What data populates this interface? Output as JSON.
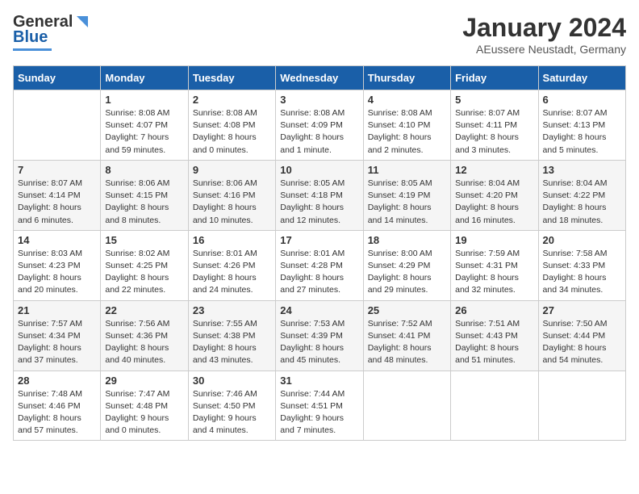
{
  "header": {
    "logo_general": "General",
    "logo_blue": "Blue",
    "month_title": "January 2024",
    "location": "AEussere Neustadt, Germany"
  },
  "days_of_week": [
    "Sunday",
    "Monday",
    "Tuesday",
    "Wednesday",
    "Thursday",
    "Friday",
    "Saturday"
  ],
  "weeks": [
    [
      {
        "day": "",
        "info": ""
      },
      {
        "day": "1",
        "info": "Sunrise: 8:08 AM\nSunset: 4:07 PM\nDaylight: 7 hours\nand 59 minutes."
      },
      {
        "day": "2",
        "info": "Sunrise: 8:08 AM\nSunset: 4:08 PM\nDaylight: 8 hours\nand 0 minutes."
      },
      {
        "day": "3",
        "info": "Sunrise: 8:08 AM\nSunset: 4:09 PM\nDaylight: 8 hours\nand 1 minute."
      },
      {
        "day": "4",
        "info": "Sunrise: 8:08 AM\nSunset: 4:10 PM\nDaylight: 8 hours\nand 2 minutes."
      },
      {
        "day": "5",
        "info": "Sunrise: 8:07 AM\nSunset: 4:11 PM\nDaylight: 8 hours\nand 3 minutes."
      },
      {
        "day": "6",
        "info": "Sunrise: 8:07 AM\nSunset: 4:13 PM\nDaylight: 8 hours\nand 5 minutes."
      }
    ],
    [
      {
        "day": "7",
        "info": "Sunrise: 8:07 AM\nSunset: 4:14 PM\nDaylight: 8 hours\nand 6 minutes."
      },
      {
        "day": "8",
        "info": "Sunrise: 8:06 AM\nSunset: 4:15 PM\nDaylight: 8 hours\nand 8 minutes."
      },
      {
        "day": "9",
        "info": "Sunrise: 8:06 AM\nSunset: 4:16 PM\nDaylight: 8 hours\nand 10 minutes."
      },
      {
        "day": "10",
        "info": "Sunrise: 8:05 AM\nSunset: 4:18 PM\nDaylight: 8 hours\nand 12 minutes."
      },
      {
        "day": "11",
        "info": "Sunrise: 8:05 AM\nSunset: 4:19 PM\nDaylight: 8 hours\nand 14 minutes."
      },
      {
        "day": "12",
        "info": "Sunrise: 8:04 AM\nSunset: 4:20 PM\nDaylight: 8 hours\nand 16 minutes."
      },
      {
        "day": "13",
        "info": "Sunrise: 8:04 AM\nSunset: 4:22 PM\nDaylight: 8 hours\nand 18 minutes."
      }
    ],
    [
      {
        "day": "14",
        "info": "Sunrise: 8:03 AM\nSunset: 4:23 PM\nDaylight: 8 hours\nand 20 minutes."
      },
      {
        "day": "15",
        "info": "Sunrise: 8:02 AM\nSunset: 4:25 PM\nDaylight: 8 hours\nand 22 minutes."
      },
      {
        "day": "16",
        "info": "Sunrise: 8:01 AM\nSunset: 4:26 PM\nDaylight: 8 hours\nand 24 minutes."
      },
      {
        "day": "17",
        "info": "Sunrise: 8:01 AM\nSunset: 4:28 PM\nDaylight: 8 hours\nand 27 minutes."
      },
      {
        "day": "18",
        "info": "Sunrise: 8:00 AM\nSunset: 4:29 PM\nDaylight: 8 hours\nand 29 minutes."
      },
      {
        "day": "19",
        "info": "Sunrise: 7:59 AM\nSunset: 4:31 PM\nDaylight: 8 hours\nand 32 minutes."
      },
      {
        "day": "20",
        "info": "Sunrise: 7:58 AM\nSunset: 4:33 PM\nDaylight: 8 hours\nand 34 minutes."
      }
    ],
    [
      {
        "day": "21",
        "info": "Sunrise: 7:57 AM\nSunset: 4:34 PM\nDaylight: 8 hours\nand 37 minutes."
      },
      {
        "day": "22",
        "info": "Sunrise: 7:56 AM\nSunset: 4:36 PM\nDaylight: 8 hours\nand 40 minutes."
      },
      {
        "day": "23",
        "info": "Sunrise: 7:55 AM\nSunset: 4:38 PM\nDaylight: 8 hours\nand 43 minutes."
      },
      {
        "day": "24",
        "info": "Sunrise: 7:53 AM\nSunset: 4:39 PM\nDaylight: 8 hours\nand 45 minutes."
      },
      {
        "day": "25",
        "info": "Sunrise: 7:52 AM\nSunset: 4:41 PM\nDaylight: 8 hours\nand 48 minutes."
      },
      {
        "day": "26",
        "info": "Sunrise: 7:51 AM\nSunset: 4:43 PM\nDaylight: 8 hours\nand 51 minutes."
      },
      {
        "day": "27",
        "info": "Sunrise: 7:50 AM\nSunset: 4:44 PM\nDaylight: 8 hours\nand 54 minutes."
      }
    ],
    [
      {
        "day": "28",
        "info": "Sunrise: 7:48 AM\nSunset: 4:46 PM\nDaylight: 8 hours\nand 57 minutes."
      },
      {
        "day": "29",
        "info": "Sunrise: 7:47 AM\nSunset: 4:48 PM\nDaylight: 9 hours\nand 0 minutes."
      },
      {
        "day": "30",
        "info": "Sunrise: 7:46 AM\nSunset: 4:50 PM\nDaylight: 9 hours\nand 4 minutes."
      },
      {
        "day": "31",
        "info": "Sunrise: 7:44 AM\nSunset: 4:51 PM\nDaylight: 9 hours\nand 7 minutes."
      },
      {
        "day": "",
        "info": ""
      },
      {
        "day": "",
        "info": ""
      },
      {
        "day": "",
        "info": ""
      }
    ]
  ]
}
